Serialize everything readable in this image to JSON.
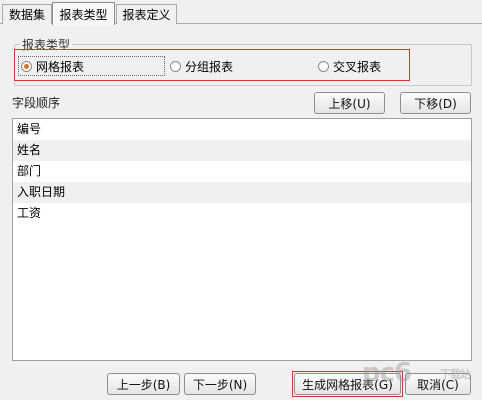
{
  "tabs": [
    {
      "label": "数据集"
    },
    {
      "label": "报表类型"
    },
    {
      "label": "报表定义"
    }
  ],
  "report_type": {
    "legend": "报表类型",
    "options": [
      {
        "label": "网格报表",
        "selected": true
      },
      {
        "label": "分组报表",
        "selected": false
      },
      {
        "label": "交叉报表",
        "selected": false
      }
    ]
  },
  "field_order": {
    "label": "字段顺序",
    "move_up": "上移(U)",
    "move_down": "下移(D)",
    "items": [
      "编号",
      "姓名",
      "部门",
      "入职日期",
      "工资"
    ]
  },
  "footer": {
    "prev": "上一步(B)",
    "next": "下一步(N)",
    "generate": "生成网格报表(G)",
    "cancel": "取消(C)"
  },
  "watermark": {
    "text": "pc6",
    "sub": "下载站"
  },
  "colors": {
    "highlight": "#e03030",
    "radio_selected": "#d8722a"
  }
}
